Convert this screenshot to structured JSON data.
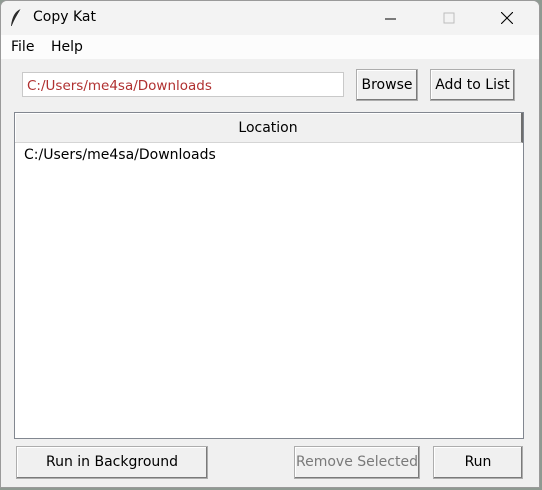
{
  "window": {
    "title": "Copy Kat",
    "icon": "feather-icon"
  },
  "menu": {
    "file": "File",
    "help": "Help"
  },
  "path_entry": {
    "value": "C:/Users/me4sa/Downloads"
  },
  "buttons": {
    "browse": "Browse",
    "add_to_list": "Add to List",
    "run_in_background": "Run in Background",
    "remove_selected": "Remove Selected",
    "run": "Run"
  },
  "table": {
    "header": "Location",
    "rows": [
      "C:/Users/me4sa/Downloads"
    ]
  },
  "colors": {
    "path_text": "#b03030",
    "disabled_text": "#7a7a7a"
  }
}
